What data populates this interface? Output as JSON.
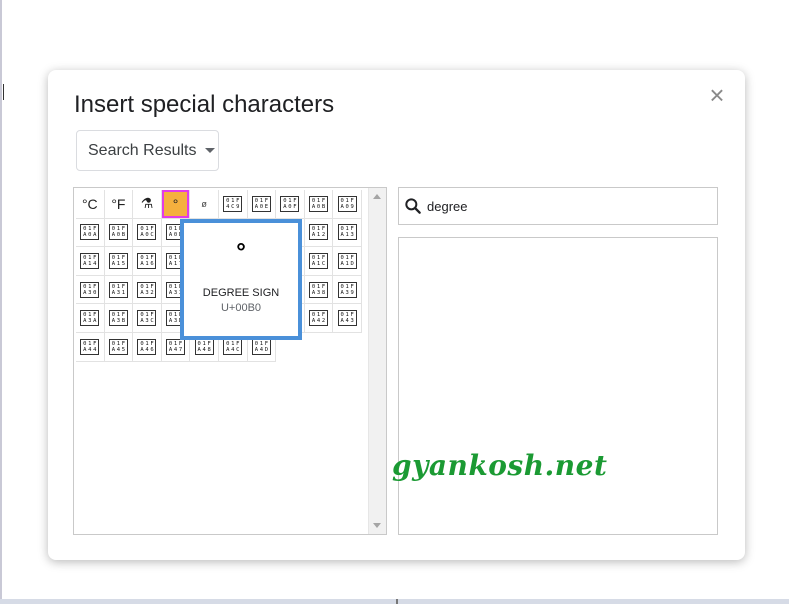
{
  "dialog": {
    "title": "Insert special characters",
    "close_symbol": "×",
    "category_dropdown": "Search Results"
  },
  "characters": {
    "row1": [
      "°C",
      "°F",
      "⚗",
      "°",
      "ø"
    ],
    "row1_codes": [
      [
        "01F",
        "4C9"
      ],
      [
        "01F",
        "A0E"
      ],
      [
        "01F",
        "A0F"
      ],
      [
        "01F",
        "A0B"
      ],
      [
        "01F",
        "A09"
      ]
    ],
    "grid_codes": [
      [
        [
          "01F",
          "A0A"
        ],
        [
          "01F",
          "A0B"
        ],
        [
          "01F",
          "A0C"
        ],
        [
          "01F",
          "A0D"
        ],
        null,
        null,
        null,
        null,
        [
          "01F",
          "A12"
        ],
        [
          "01F",
          "A13"
        ]
      ],
      [
        [
          "01F",
          "A14"
        ],
        [
          "01F",
          "A15"
        ],
        [
          "01F",
          "A16"
        ],
        [
          "01F",
          "A17"
        ],
        null,
        null,
        null,
        null,
        [
          "01F",
          "A1C"
        ],
        [
          "01F",
          "A1D"
        ]
      ],
      [
        [
          "01F",
          "A30"
        ],
        [
          "01F",
          "A31"
        ],
        [
          "01F",
          "A32"
        ],
        [
          "01F",
          "A33"
        ],
        null,
        null,
        null,
        null,
        [
          "01F",
          "A38"
        ],
        [
          "01F",
          "A39"
        ]
      ],
      [
        [
          "01F",
          "A3A"
        ],
        [
          "01F",
          "A3B"
        ],
        [
          "01F",
          "A3C"
        ],
        [
          "01F",
          "A3D"
        ],
        null,
        null,
        null,
        null,
        [
          "01F",
          "A42"
        ],
        [
          "01F",
          "A43"
        ]
      ],
      [
        [
          "01F",
          "A44"
        ],
        [
          "01F",
          "A45"
        ],
        [
          "01F",
          "A46"
        ],
        [
          "01F",
          "A47"
        ],
        [
          "01F",
          "A48"
        ],
        [
          "01F",
          "A4C"
        ],
        [
          "01F",
          "A4D"
        ]
      ]
    ]
  },
  "preview": {
    "glyph": "°",
    "name": "DEGREE SIGN",
    "code": "U+00B0"
  },
  "search": {
    "value": "degree"
  },
  "watermark": "gyankosh.net",
  "colors": {
    "selected_bg": "#f5b03e",
    "selected_border": "#e23ce6",
    "preview_border": "#4a90d9",
    "watermark": "#1b9a33"
  }
}
